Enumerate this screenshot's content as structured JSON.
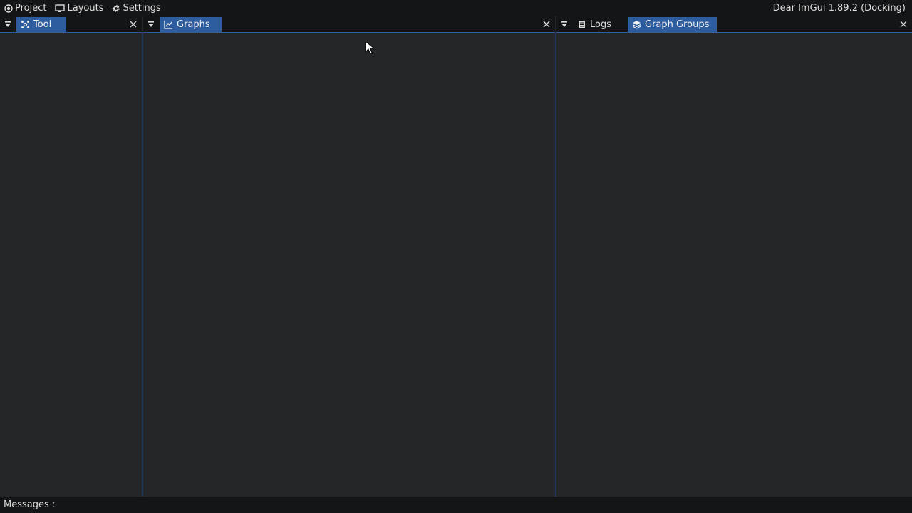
{
  "menubar": {
    "items": [
      {
        "label": "Project",
        "icon": "circle-dot-icon"
      },
      {
        "label": "Layouts",
        "icon": "monitor-icon"
      },
      {
        "label": "Settings",
        "icon": "gear-icon"
      }
    ],
    "version": "Dear ImGui 1.89.2 (Docking)"
  },
  "docks": {
    "left": {
      "tabs": [
        {
          "label": "Tool",
          "icon": "network-icon",
          "active": true
        }
      ]
    },
    "center": {
      "tabs": [
        {
          "label": "Graphs",
          "icon": "line-chart-icon",
          "active": true
        }
      ]
    },
    "right": {
      "tabs": [
        {
          "label": "Logs",
          "icon": "list-icon",
          "active": false
        },
        {
          "label": "Graph Groups",
          "icon": "layers-icon",
          "active": true
        }
      ]
    }
  },
  "statusbar": {
    "messages_label": "Messages :"
  },
  "colors": {
    "accent": "#2d5d9f",
    "bar": "#141517",
    "panel": "#252628"
  }
}
